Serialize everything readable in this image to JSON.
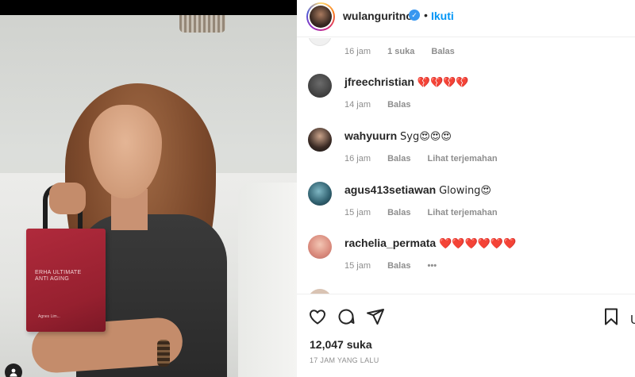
{
  "photo": {
    "bag_text": "ERHA ULTIMATE ANTI AGING",
    "bag_small": "Agnes Lim..."
  },
  "header": {
    "username": "wulanguritno",
    "separator": "•",
    "follow_label": "Ikuti",
    "verified_mark": "✓"
  },
  "comments": [
    {
      "meta": {
        "time": "16 jam",
        "likes": "1 suka",
        "reply": "Balas"
      }
    },
    {
      "user": "jfreechristian",
      "text": "💔💔💔💔",
      "meta": {
        "time": "14 jam",
        "reply": "Balas"
      }
    },
    {
      "user": "wahyuurn",
      "text": "Syg😍😍😍",
      "meta": {
        "time": "16 jam",
        "reply": "Balas",
        "translate": "Lihat terjemahan"
      }
    },
    {
      "user": "agus413setiawan",
      "text": "Glowing😍",
      "meta": {
        "time": "15 jam",
        "reply": "Balas",
        "translate": "Lihat terjemahan"
      }
    },
    {
      "user": "rachelia_permata",
      "text": "❤️❤️❤️❤️❤️❤️",
      "meta": {
        "time": "15 jam",
        "reply": "Balas",
        "more": "•••"
      }
    }
  ],
  "actions": {
    "likes_count": "12,047 suka",
    "time_ago": "17 JAM YANG LALU",
    "cut_letter": "U"
  },
  "colors": {
    "accent": "#0095f6",
    "verified": "#3897f0",
    "heart": "#ed4956",
    "muted": "#8e8e8e"
  }
}
